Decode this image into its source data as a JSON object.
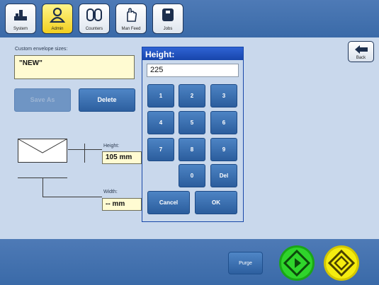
{
  "tabs": [
    {
      "label": "System",
      "icon": "system-icon"
    },
    {
      "label": "Admin",
      "icon": "admin-icon",
      "active": true
    },
    {
      "label": "Counters",
      "icon": "counters-icon"
    },
    {
      "label": "Man Feed",
      "icon": "man-feed-icon"
    },
    {
      "label": "Jobs",
      "icon": "jobs-icon"
    }
  ],
  "back": {
    "label": "Back"
  },
  "envelope": {
    "sizes_label": "Custom envelope sizes:",
    "selected": "\"NEW\"",
    "save_as": "Save As",
    "delete": "Delete",
    "height_label": "Height:",
    "height_value": "105 mm",
    "width_label": "Width:",
    "width_value": "-- mm"
  },
  "dialog": {
    "title": "Height:",
    "value": "225",
    "keys": [
      "1",
      "2",
      "3",
      "4",
      "5",
      "6",
      "7",
      "8",
      "9",
      "0",
      "Del"
    ],
    "cancel": "Cancel",
    "ok": "OK"
  },
  "bottom": {
    "purge": "Purge",
    "start_icon": "start-icon",
    "stop_icon": "stop-icon"
  },
  "colors": {
    "bar": "#3a6aa8",
    "panel": "#c9d8ec",
    "active_tab": "#f2cf1e",
    "start": "#22c41e",
    "stop": "#f0e800"
  }
}
